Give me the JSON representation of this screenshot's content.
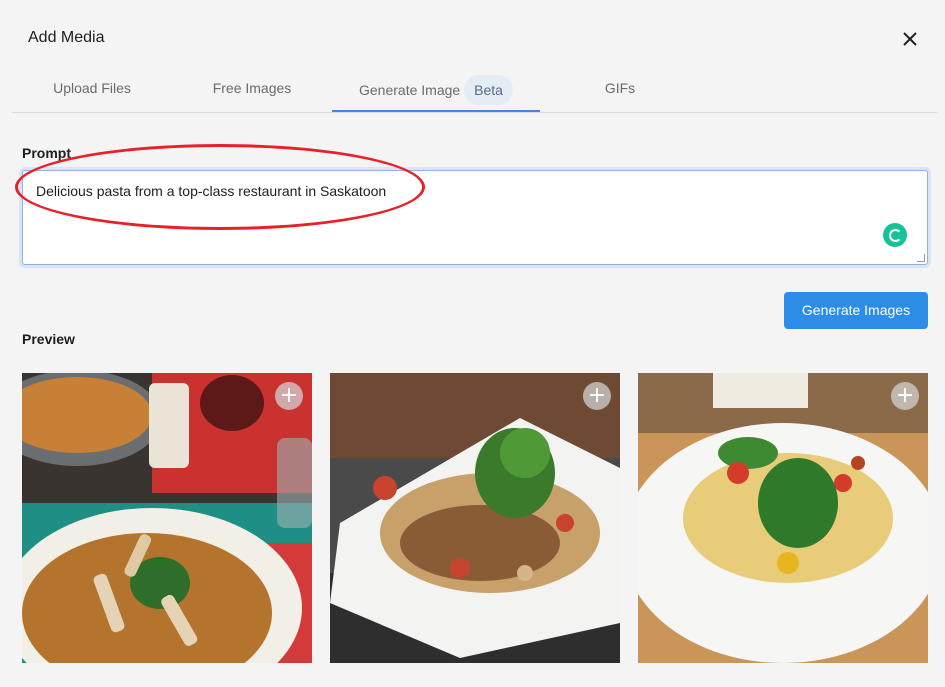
{
  "dialog": {
    "title": "Add Media"
  },
  "tabs": [
    {
      "label": "Upload Files"
    },
    {
      "label": "Free Images"
    },
    {
      "label": "Generate Image",
      "badge": "Beta",
      "active": true
    },
    {
      "label": "GIFs"
    }
  ],
  "prompt": {
    "label": "Prompt",
    "value": "Delicious pasta from a top-class restaurant in Saskatoon"
  },
  "generate_button": {
    "label": "Generate Images"
  },
  "preview": {
    "label": "Preview",
    "add_symbol": "+",
    "images": [
      {
        "subject": "pasta with sauce in a pan, candle and wine glass"
      },
      {
        "subject": "penne pasta with greens on a white square plate"
      },
      {
        "subject": "pappardelle with basil and tomatoes in a white bowl"
      }
    ]
  },
  "icons": {
    "close": "close-icon",
    "grammarly": "grammarly-icon",
    "add": "plus-icon"
  },
  "colors": {
    "accent": "#2d8ce6",
    "annotation": "#e8202a",
    "grammarly": "#15c39a",
    "active_tab_underline": "#4a86d8"
  }
}
